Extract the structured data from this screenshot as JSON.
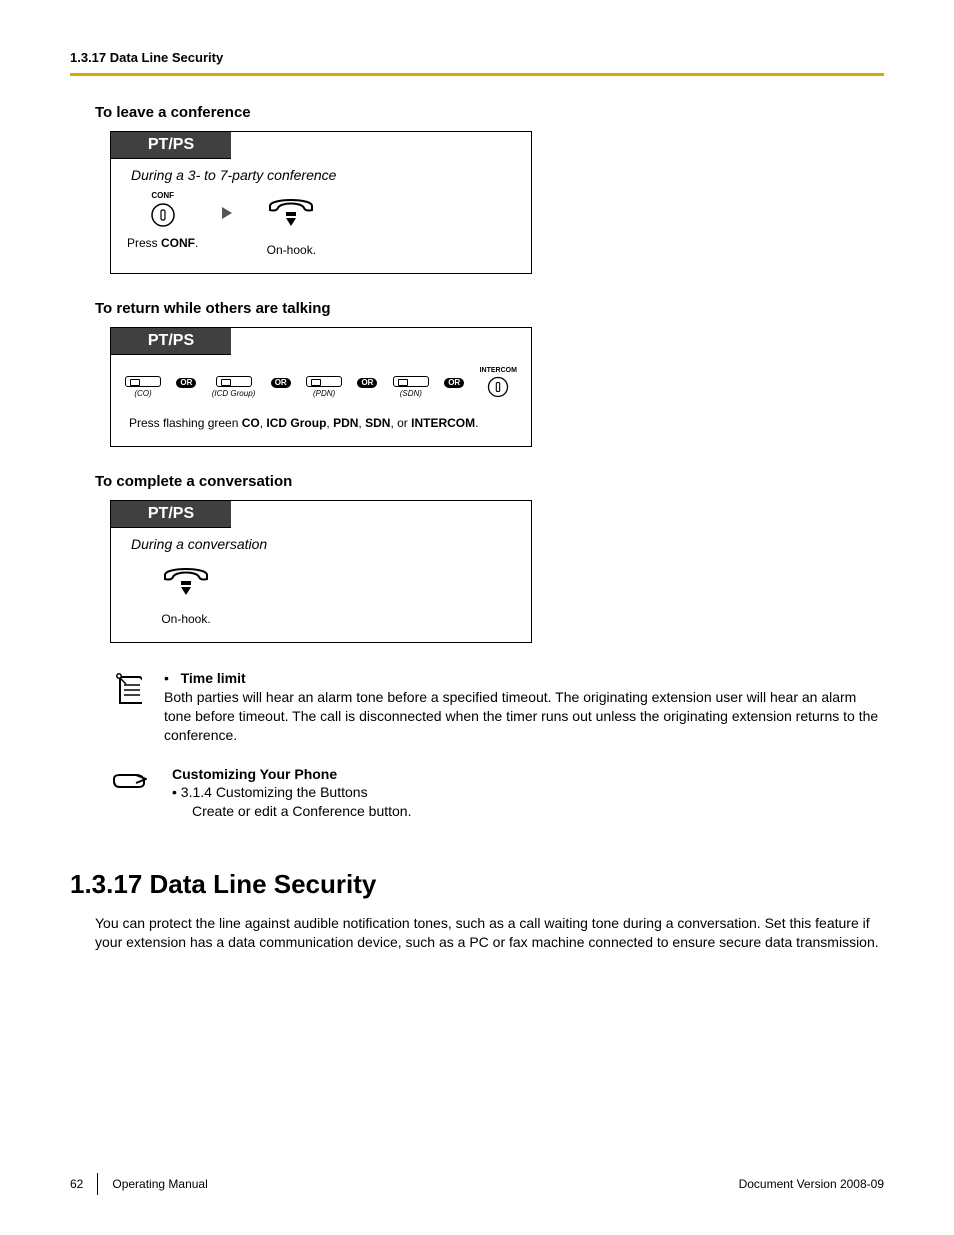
{
  "running_head": "1.3.17 Data Line Security",
  "procedures": [
    {
      "heading": "To leave a conference",
      "tab": "PT/PS",
      "state": "During a 3- to 7-party conference",
      "steps": [
        {
          "kind": "conf",
          "label_top": "CONF",
          "caption_html": "Press <b>CONF</b>."
        },
        {
          "kind": "arrow"
        },
        {
          "kind": "onhook",
          "caption_html": "On-hook."
        }
      ]
    },
    {
      "heading": "To return while others are talking",
      "tab": "PT/PS",
      "keys": [
        {
          "sub": "(CO)"
        },
        {
          "or": "OR"
        },
        {
          "sub": "(ICD Group)"
        },
        {
          "or": "OR"
        },
        {
          "sub": "(PDN)"
        },
        {
          "or": "OR"
        },
        {
          "sub": "(SDN)"
        },
        {
          "or": "OR"
        },
        {
          "intercom": "INTERCOM"
        }
      ],
      "instruction_html": "Press flashing green <b>CO</b>, <b>ICD Group</b>, <b>PDN</b>, <b>SDN</b>, or <b>INTERCOM</b>."
    },
    {
      "heading": "To complete a conversation",
      "tab": "PT/PS",
      "state": "During a conversation",
      "steps": [
        {
          "kind": "onhook",
          "caption_html": "On-hook."
        }
      ]
    }
  ],
  "notes": [
    {
      "icon": "notepad",
      "bullet": "•",
      "title": "Time limit",
      "body": "Both parties will hear an alarm tone before a specified timeout. The originating extension user will hear an alarm tone before timeout. The call is disconnected when the timer runs out unless the originating extension returns to the conference."
    },
    {
      "icon": "hand",
      "title": "Customizing Your Phone",
      "lines": [
        "•   3.1.4  Customizing the Buttons",
        "Create or edit a Conference button."
      ]
    }
  ],
  "section": {
    "title": "1.3.17  Data Line Security",
    "body": "You can protect the line against audible notification tones, such as a call waiting tone during a conversation. Set this feature if your extension has a data communication device, such as a PC or fax machine connected to ensure secure data transmission."
  },
  "footer": {
    "page": "62",
    "manual": "Operating Manual",
    "version": "Document Version  2008-09"
  }
}
